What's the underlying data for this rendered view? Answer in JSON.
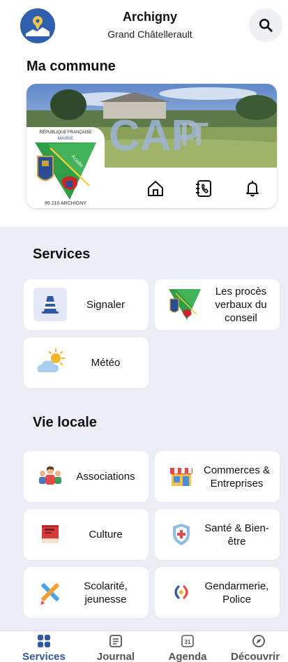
{
  "header": {
    "town_name": "Archigny",
    "town_subtitle": "Grand Châtellerault",
    "logo_icon": "map-pin-logo-icon",
    "search_icon": "search-icon"
  },
  "commune": {
    "title": "Ma commune",
    "crest": {
      "republic_text": "RÉPUBLIQUE FRANÇAISE",
      "mairie_text": "MAIRIE",
      "acadie_text": "Acadie",
      "code_text": "86 210 ARCHIGNY"
    },
    "actions": [
      {
        "name": "home",
        "icon": "home-icon"
      },
      {
        "name": "contact",
        "icon": "phone-book-icon"
      },
      {
        "name": "notifications",
        "icon": "bell-icon"
      }
    ]
  },
  "services": {
    "title": "Services",
    "items": [
      {
        "label": "Signaler",
        "icon": "traffic-cone-icon"
      },
      {
        "label": "Les procès verbaux du conseil",
        "icon": "mairie-crest-icon"
      },
      {
        "label": "Météo",
        "icon": "weather-sun-cloud-icon"
      }
    ]
  },
  "vie_locale": {
    "title": "Vie locale",
    "items": [
      {
        "label": "Associations",
        "icon": "people-group-icon"
      },
      {
        "label": "Commerces & Entreprises",
        "icon": "shop-icon"
      },
      {
        "label": "Culture",
        "icon": "book-icon"
      },
      {
        "label": "Santé & Bien-être",
        "icon": "health-shield-icon"
      },
      {
        "label": "Scolarité, jeunesse",
        "icon": "pencil-ruler-icon"
      },
      {
        "label": "Gendarmerie, Police",
        "icon": "police-siren-icon"
      }
    ]
  },
  "nav": {
    "items": [
      {
        "label": "Services",
        "icon": "grid-icon",
        "active": true
      },
      {
        "label": "Journal",
        "icon": "newspaper-icon",
        "active": false
      },
      {
        "label": "Agenda",
        "icon": "calendar-icon",
        "day": "31",
        "active": false
      },
      {
        "label": "Découvrir",
        "icon": "compass-icon",
        "active": false
      }
    ]
  },
  "colors": {
    "accent": "#2e58a3",
    "background_gray": "#eceef6",
    "tile_background": "#ffffff"
  }
}
